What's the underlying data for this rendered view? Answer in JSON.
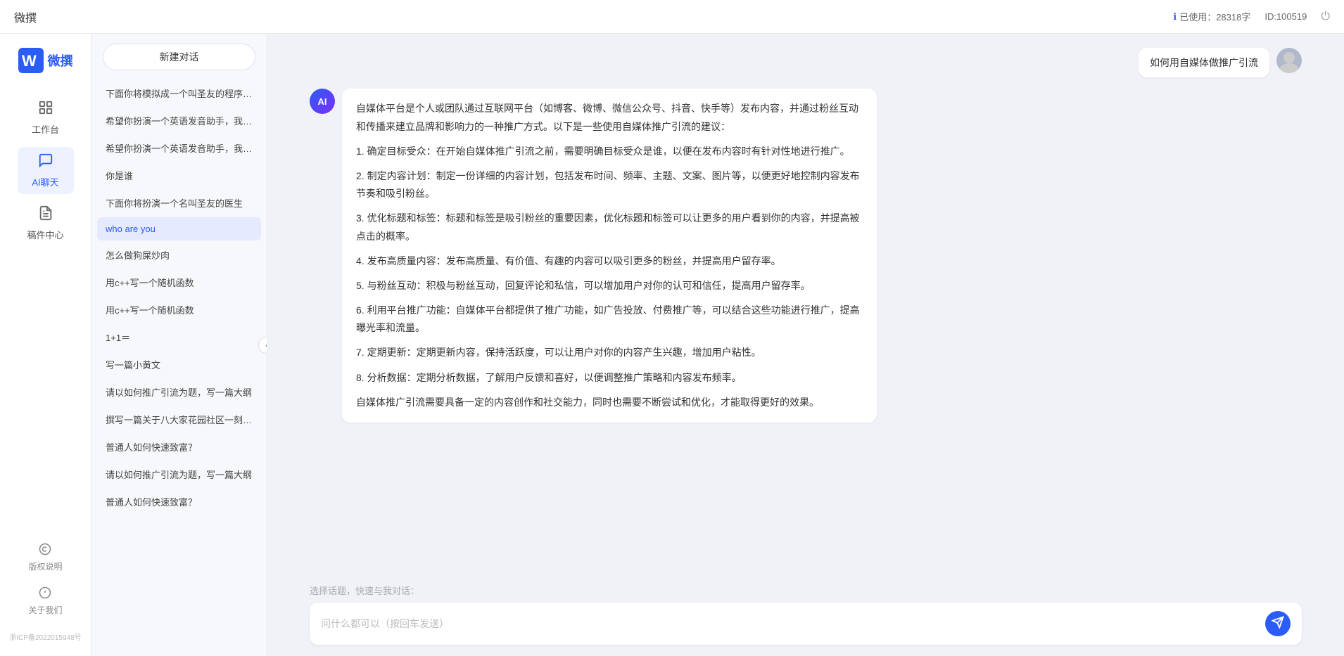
{
  "topbar": {
    "title": "微撰",
    "usage_label": "已使用：28318字",
    "id_label": "ID:100519",
    "usage_icon": "ℹ",
    "power_icon": "⏻"
  },
  "left_nav": {
    "logo_text": "微撰",
    "items": [
      {
        "id": "workbench",
        "label": "工作台",
        "icon": "⊞"
      },
      {
        "id": "ai_chat",
        "label": "AI聊天",
        "icon": "💬"
      },
      {
        "id": "drafts",
        "label": "稿件中心",
        "icon": "📄"
      }
    ],
    "bottom_items": [
      {
        "id": "copyright",
        "label": "版权说明",
        "icon": "©"
      },
      {
        "id": "about",
        "label": "关于我们",
        "icon": "ℹ"
      }
    ],
    "icp": "浙ICP备2022015948号"
  },
  "sidebar": {
    "new_btn_label": "新建对话",
    "items": [
      {
        "id": 1,
        "text": "下面你将模拟成一个叫圣友的程序员，我说..."
      },
      {
        "id": 2,
        "text": "希望你扮演一个英语发音助手，我提供给你..."
      },
      {
        "id": 3,
        "text": "希望你扮演一个英语发音助手，我提供给你..."
      },
      {
        "id": 4,
        "text": "你是谁"
      },
      {
        "id": 5,
        "text": "下面你将扮演一个名叫圣友的医生"
      },
      {
        "id": 6,
        "text": "who are you",
        "active": true
      },
      {
        "id": 7,
        "text": "怎么做狗屎炒肉"
      },
      {
        "id": 8,
        "text": "用c++写一个随机函数"
      },
      {
        "id": 9,
        "text": "用c++写一个随机函数"
      },
      {
        "id": 10,
        "text": "1+1＝"
      },
      {
        "id": 11,
        "text": "写一篇小黄文"
      },
      {
        "id": 12,
        "text": "请以如何推广引流为题，写一篇大纲"
      },
      {
        "id": 13,
        "text": "撰写一篇关于八大家花园社区一刻钟便民生..."
      },
      {
        "id": 14,
        "text": "普通人如何快速致富？"
      },
      {
        "id": 15,
        "text": "请以如何推广引流为题，写一篇大纲"
      },
      {
        "id": 16,
        "text": "普通人如何快速致富？"
      }
    ]
  },
  "chat": {
    "messages": [
      {
        "id": 1,
        "role": "user",
        "text": "如何用自媒体做推广引流"
      },
      {
        "id": 2,
        "role": "ai",
        "paragraphs": [
          "自媒体平台是个人或团队通过互联网平台（如博客、微博、微信公众号、抖音、快手等）发布内容，并通过粉丝互动和传播来建立品牌和影响力的一种推广方式。以下是一些使用自媒体推广引流的建议：",
          "1. 确定目标受众：在开始自媒体推广引流之前，需要明确目标受众是谁，以便在发布内容时有针对性地进行推广。",
          "2. 制定内容计划：制定一份详细的内容计划，包括发布时间、频率、主题、文案、图片等，以便更好地控制内容发布节奏和吸引粉丝。",
          "3. 优化标题和标签：标题和标签是吸引粉丝的重要因素，优化标题和标签可以让更多的用户看到你的内容，并提高被点击的概率。",
          "4. 发布高质量内容：发布高质量、有价值、有趣的内容可以吸引更多的粉丝，并提高用户留存率。",
          "5. 与粉丝互动：积极与粉丝互动，回复评论和私信，可以增加用户对你的认可和信任，提高用户留存率。",
          "6. 利用平台推广功能：自媒体平台都提供了推广功能，如广告投放、付费推广等，可以结合这些功能进行推广，提高曝光率和流量。",
          "7. 定期更新：定期更新内容，保持活跃度，可以让用户对你的内容产生兴趣，增加用户粘性。",
          "8. 分析数据：定期分析数据，了解用户反馈和喜好，以便调整推广策略和内容发布频率。",
          "自媒体推广引流需要具备一定的内容创作和社交能力，同时也需要不断尝试和优化，才能取得更好的效果。"
        ]
      }
    ],
    "quick_topics_label": "选择话题，快速与我对话：",
    "input_placeholder": "问什么都可以（按回车发送）"
  }
}
